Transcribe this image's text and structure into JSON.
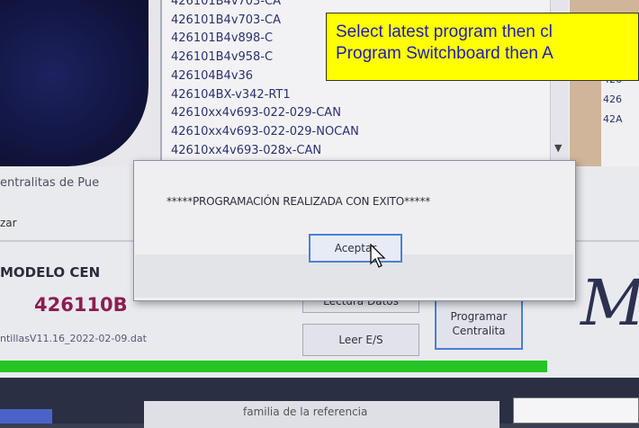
{
  "program_list": {
    "items": [
      "426101B4v703-CA",
      "426101B4v898-C",
      "426101B4v958-C",
      "426104B4v36",
      "426104BX-v342-RT1",
      "42610xx4v693-022-029-CAN",
      "42610xx4v693-022-029-NOCAN",
      "42610xx4v693-028x-CAN"
    ],
    "right_items": [
      "426",
      "426",
      "42A"
    ]
  },
  "instruction": {
    "line1": "Select latest program then cl",
    "line2": "Program Switchboard then A"
  },
  "window": {
    "title": "entralitas de Pue",
    "menu_item": "zar"
  },
  "model": {
    "label": "MODELO CEN",
    "value": "426110B"
  },
  "file": {
    "name": "ntillasV11.16_2022-02-09.dat"
  },
  "buttons": {
    "leer_datos": "Lectura Datos",
    "leer_es": "Leer E/S",
    "programar_line1": "Programar",
    "programar_line2": "Centralita"
  },
  "brand_letter": "M",
  "bottom": {
    "label": "familia de la referencia"
  },
  "progress": {
    "value": 1.0,
    "color": "#26c424"
  },
  "dialog": {
    "message": "*****PROGRAMACIÓN REALIZADA CON EXITO*****",
    "ok_label": "Aceptar"
  },
  "colors": {
    "banner": "#ffff00",
    "banner_text": "#1c1cb8",
    "model_value": "#8c1d52",
    "accent_border": "#4b81d6"
  },
  "icons": {
    "cursor": "mouse-pointer-icon",
    "scroll": "chevron-down-icon"
  }
}
